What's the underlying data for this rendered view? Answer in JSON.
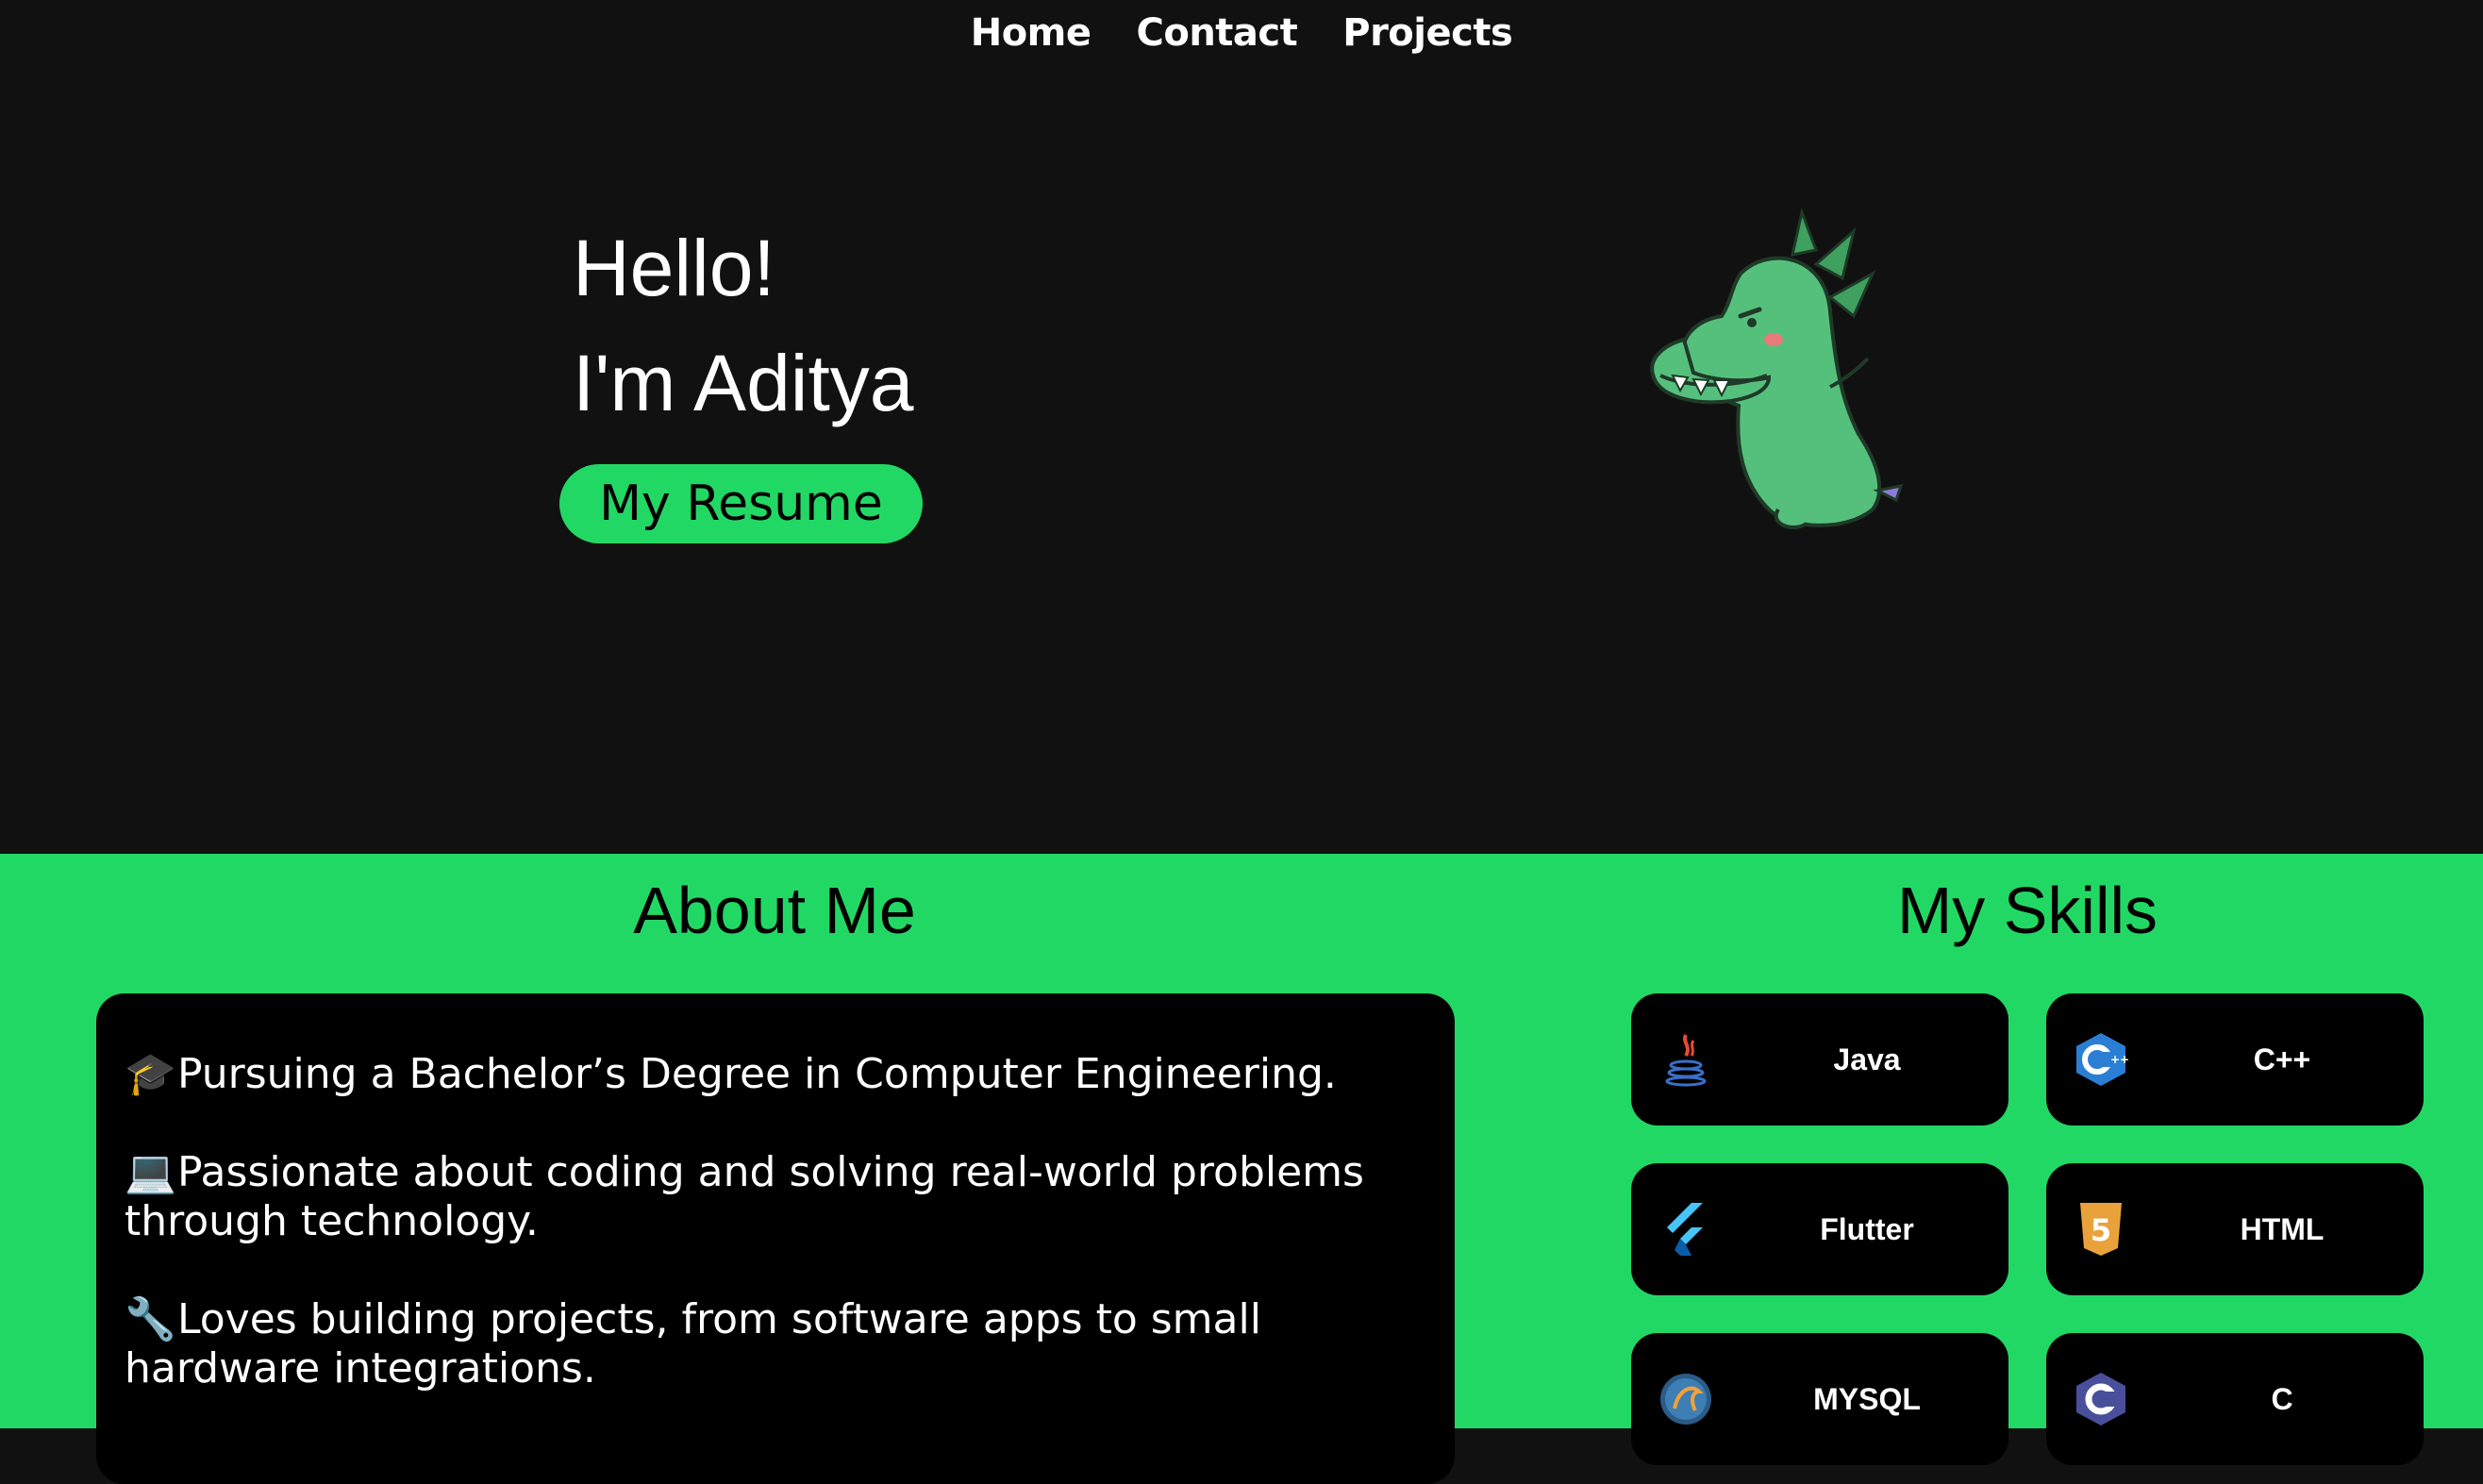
{
  "nav": {
    "home": "Home",
    "contact": "Contact",
    "projects": "Projects"
  },
  "hero": {
    "greeting": "Hello!",
    "name": "I'm Aditya",
    "resume_button": "My Resume"
  },
  "about": {
    "title": "About Me",
    "lines": [
      {
        "icon": "graduation-cap-icon",
        "emoji": "🎓",
        "text": "Pursuing a Bachelor’s Degree in Computer Engineering."
      },
      {
        "icon": "laptop-icon",
        "emoji": "💻",
        "text": "Passionate about coding and solving real-world problems through technology."
      },
      {
        "icon": "wrench-icon",
        "emoji": "🔧",
        "text": "Loves building projects, from software apps to small hardware integrations."
      }
    ]
  },
  "skills": {
    "title": "My Skills",
    "items": [
      {
        "name": "Java",
        "icon": "java-icon"
      },
      {
        "name": "C++",
        "icon": "cpp-icon"
      },
      {
        "name": "Flutter",
        "icon": "flutter-icon"
      },
      {
        "name": "HTML",
        "icon": "html5-icon"
      },
      {
        "name": "MYSQL",
        "icon": "mysql-icon"
      },
      {
        "name": "C",
        "icon": "c-icon"
      }
    ]
  },
  "colors": {
    "background": "#111111",
    "accent": "#22d865",
    "card": "#000000",
    "dino": "#55c07c"
  }
}
